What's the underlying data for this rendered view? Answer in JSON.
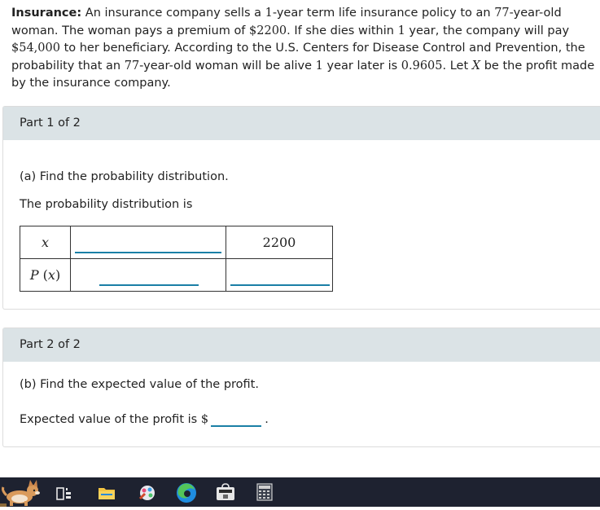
{
  "problem": {
    "bold_label": "Insurance:",
    "t1": " An insurance company sells a ",
    "n1": "1",
    "t2": "-year term life insurance policy to an ",
    "n2": "77",
    "t3": "-year-old woman. The woman pays a premium of ",
    "n3": "$2200",
    "t4": ". If she dies within ",
    "n4": "1",
    "t5": " year, the company will pay ",
    "n5": "$54,000",
    "t6": " to her beneficiary. According to the U.S. Centers for Disease Control and Prevention, the probability that an ",
    "n6": "77",
    "t7": "-year-old woman will be alive ",
    "n7": "1",
    "t8": " year later is ",
    "n8": "0.9605",
    "t9": ". Let ",
    "n9": "X",
    "t10": " be the profit made by the insurance company."
  },
  "part1": {
    "header": "Part 1 of 2",
    "question": "(a) Find the probability distribution.",
    "subtext": "The probability distribution is",
    "row1_label": "x",
    "row2_label": "P (x)",
    "row1_value2": "2200"
  },
  "part2": {
    "header": "Part 2 of 2",
    "question": "(b) Find the expected value of the profit.",
    "answer_prefix": "Expected value of the profit is ",
    "currency": "$",
    "suffix": "."
  },
  "taskbar": {
    "icons": [
      "corgi-widget-icon",
      "task-view-icon",
      "file-explorer-icon",
      "snipping-tool-icon",
      "edge-browser-icon",
      "store-icon",
      "calculator-icon"
    ]
  }
}
